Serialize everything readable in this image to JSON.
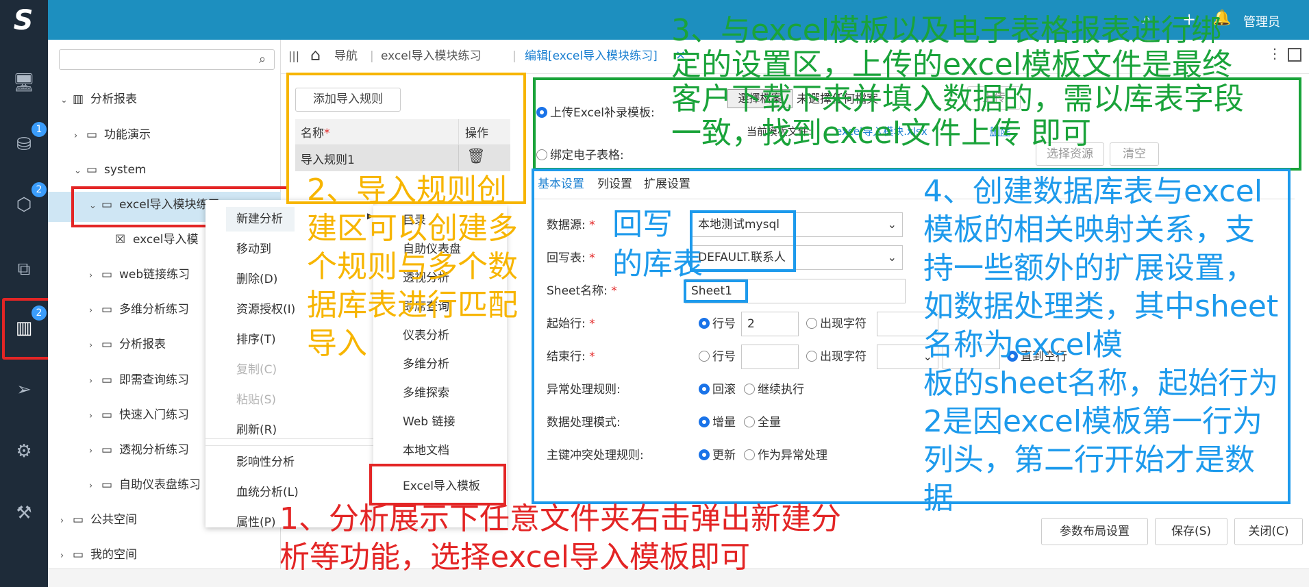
{
  "topbar": {
    "user_label": "管理员",
    "bg": "#1d8fbf"
  },
  "leftbar": {
    "icons": [
      {
        "name": "monitor-icon",
        "glyph": "🖥"
      },
      {
        "name": "database-gear-icon",
        "glyph": "⛁",
        "badge": "1"
      },
      {
        "name": "cube-icon",
        "glyph": "⬡",
        "badge": "2"
      },
      {
        "name": "layers-icon",
        "glyph": "⧉"
      },
      {
        "name": "bar-chart-icon",
        "glyph": "▥",
        "badge": "2"
      },
      {
        "name": "send-icon",
        "glyph": "➢"
      },
      {
        "name": "user-gear-icon",
        "glyph": "⚙"
      },
      {
        "name": "tools-icon",
        "glyph": "⚒"
      }
    ]
  },
  "tree": {
    "search_placeholder": "",
    "items": [
      {
        "label": "分析报表",
        "chev": "⌄",
        "icon": "▥"
      },
      {
        "label": "功能演示",
        "chev": "›",
        "icon": "▭"
      },
      {
        "label": "system",
        "chev": "⌄",
        "icon": "▭"
      },
      {
        "label": "excel导入模块练习",
        "chev": "⌄",
        "icon": "▭"
      },
      {
        "label": "excel导入模",
        "chev": "",
        "icon": "☒"
      },
      {
        "label": "web链接练习",
        "chev": "›",
        "icon": "▭"
      },
      {
        "label": "多维分析练习",
        "chev": "›",
        "icon": "▭"
      },
      {
        "label": "分析报表",
        "chev": "›",
        "icon": "▭"
      },
      {
        "label": "即需查询练习",
        "chev": "›",
        "icon": "▭"
      },
      {
        "label": "快速入门练习",
        "chev": "›",
        "icon": "▭"
      },
      {
        "label": "透视分析练习",
        "chev": "›",
        "icon": "▭"
      },
      {
        "label": "自助仪表盘练习",
        "chev": "›",
        "icon": "▭"
      },
      {
        "label": "公共空间",
        "chev": "›",
        "icon": "▭"
      },
      {
        "label": "我的空间",
        "chev": "›",
        "icon": "▭"
      }
    ]
  },
  "context_menu": {
    "items": [
      {
        "label": "新建分析",
        "disabled": false
      },
      {
        "label": "移动到",
        "disabled": false
      },
      {
        "label": "删除(D)",
        "disabled": false
      },
      {
        "label": "资源授权(I)",
        "disabled": false
      },
      {
        "label": "排序(T)",
        "disabled": false
      },
      {
        "label": "复制(C)",
        "disabled": true
      },
      {
        "label": "粘贴(S)",
        "disabled": true
      },
      {
        "label": "刷新(R)",
        "disabled": false
      },
      {
        "label": "影响性分析",
        "disabled": false
      },
      {
        "label": "血统分析(L)",
        "disabled": false
      },
      {
        "label": "属性(P)",
        "disabled": false
      }
    ]
  },
  "submenu": {
    "items": [
      "目录",
      "自助仪表盘",
      "透视分析",
      "即席查询",
      "仪表分析",
      "多维分析",
      "多维探索",
      "Web 链接",
      "本地文档",
      "Excel导入模板"
    ]
  },
  "breadcrumb": {
    "nav": "导航",
    "file": "excel导入模块练习",
    "tab": "编辑[excel导入模块练习]"
  },
  "rules": {
    "add_button": "添加导入规则",
    "col_name": "名称",
    "col_action": "操作",
    "rows": [
      {
        "name": "导入规则1"
      }
    ]
  },
  "template": {
    "upload_label": "上传Excel补录模板:",
    "choose_file_button": "選擇檔案",
    "no_file_text": "未選擇任何檔案",
    "upload_button": "上传",
    "current_file_label": "当前模板文件:",
    "current_file_name": "excel导入模块.xlsx",
    "delete_link": "删除",
    "bind_label": "绑定电子表格:",
    "choose_resource_button": "选择资源",
    "clear_button": "清空"
  },
  "settings": {
    "tabs": [
      "基本设置",
      "列设置",
      "扩展设置"
    ],
    "datasource_label": "数据源:",
    "datasource_value": "本地测试mysql",
    "writeback_label": "回写表:",
    "writeback_value": "DEFAULT.联系人",
    "sheet_label": "Sheet名称:",
    "sheet_value": "Sheet1",
    "start_label": "起始行:",
    "row_no": "行号",
    "start_value": "2",
    "appear_char": "出现字符",
    "end_label": "结束行:",
    "until_blank": "直到空行",
    "error_label": "异常处理规则:",
    "rollback": "回滚",
    "continue": "继续执行",
    "mode_label": "数据处理模式:",
    "increment": "增量",
    "full": "全量",
    "pk_label": "主键冲突处理规则:",
    "update": "更新",
    "as_error": "作为异常处理"
  },
  "footer_buttons": {
    "layout": "参数布局设置",
    "save": "保存(S)",
    "close": "关闭(C)"
  },
  "annotations": {
    "a1_line1": "1、分析展示下任意文件夹右击弹出新建分",
    "a1_line2": "析等功能，选择excel导入模板即可",
    "a2_lines": [
      "2、导入规则创",
      "建区可以创建多",
      "个规则与多个数",
      "据库表进行匹配",
      "导入"
    ],
    "a3_lines": [
      "3、与excel模板以及电子表格报表进行绑",
      "定的设置区，上传的excel模板文件是最终",
      "客户下载下来并填入数据的，需以库表字段",
      "一致，找到excel文件上传            即可"
    ],
    "a4_lines": [
      "4、创建数据库表与excel",
      "模板的相关映射关系，支",
      "持一些额外的扩展设置，",
      "如数据处理类，其中sheet",
      "               名称为excel模",
      "板的sheet名称，起始行为",
      "2是因excel模板第一行为",
      "列头，第二行开始才是数",
      "据"
    ],
    "writeback_line1": "回写",
    "writeback_line2": "的库表"
  },
  "colors": {
    "red": "#e32525",
    "yellow": "#f7b500",
    "green": "#1aa33a",
    "blue": "#1d9aec"
  }
}
